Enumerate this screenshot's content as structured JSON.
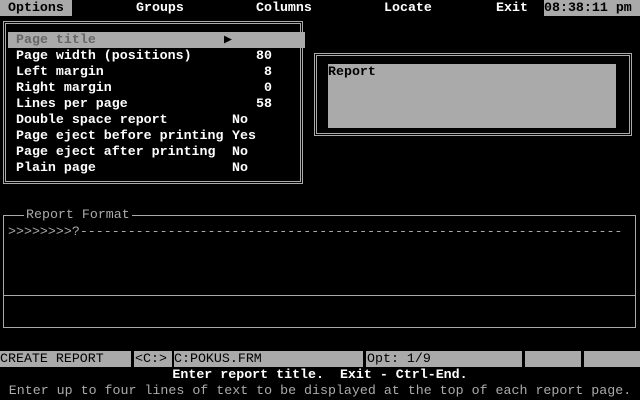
{
  "menu_bar": {
    "items": [
      {
        "label": "Options",
        "selected": true
      },
      {
        "label": "Groups"
      },
      {
        "label": "Columns"
      },
      {
        "label": "Locate"
      },
      {
        "label": "Exit"
      }
    ],
    "clock": "08:38:11 pm"
  },
  "options_menu": {
    "items": [
      {
        "label": "Page title",
        "value": "▶"
      },
      {
        "label": "Page width (positions)",
        "value": "80"
      },
      {
        "label": "Left margin",
        "value": "8"
      },
      {
        "label": "Right margin",
        "value": "0"
      },
      {
        "label": "Lines per page",
        "value": "58"
      },
      {
        "label": "Double space report",
        "value": "No"
      },
      {
        "label": "Page eject before printing",
        "value": "Yes"
      },
      {
        "label": "Page eject after printing",
        "value": "No"
      },
      {
        "label": "Plain page",
        "value": "No"
      }
    ]
  },
  "page_title_editor": {
    "text": "Report"
  },
  "report_format": {
    "title": "Report Format",
    "line": ">>>>>>>>?--------------------------------------------------------------------"
  },
  "status_bar": {
    "mode": "CREATE REPORT",
    "drive": "<C:>",
    "file": "C:POKUS.FRM",
    "option": "Opt: 1/9"
  },
  "messages": {
    "prompt": "Enter report title.  Exit - Ctrl-End.",
    "help": "Enter up to four lines of text to be displayed at the top of each report page."
  }
}
